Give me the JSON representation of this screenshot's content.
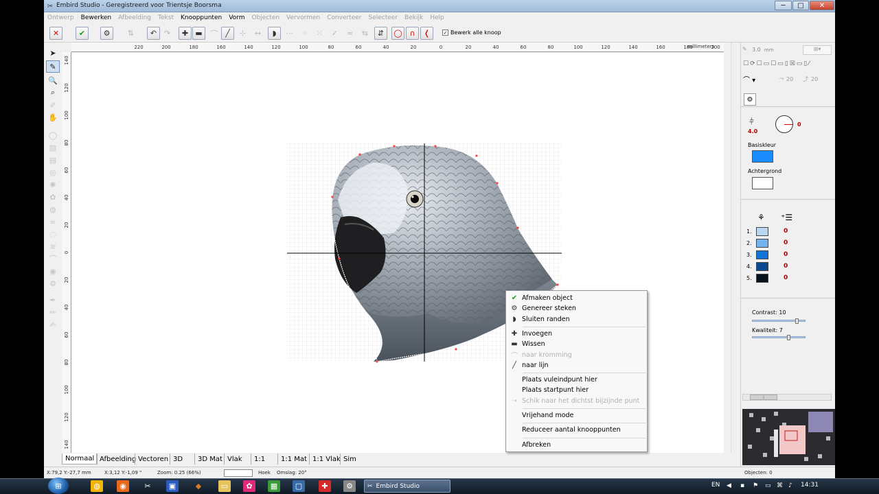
{
  "window": {
    "title": "Embird Studio - Geregistreerd voor Trientsje Boorsma",
    "buttons": {
      "minimize": "─",
      "maximize": "□",
      "close": "✕"
    }
  },
  "menu": [
    {
      "label": "Ontwerp",
      "enabled": false
    },
    {
      "label": "Bewerken",
      "enabled": true
    },
    {
      "label": "Afbeelding",
      "enabled": false
    },
    {
      "label": "Tekst",
      "enabled": false
    },
    {
      "label": "Knooppunten",
      "enabled": true
    },
    {
      "label": "Vorm",
      "enabled": true
    },
    {
      "label": "Objecten",
      "enabled": false
    },
    {
      "label": "Vervormen",
      "enabled": false
    },
    {
      "label": "Converteer",
      "enabled": false
    },
    {
      "label": "Selecteer",
      "enabled": false
    },
    {
      "label": "Bekijk",
      "enabled": false
    },
    {
      "label": "Help",
      "enabled": false
    }
  ],
  "toolbar": {
    "checkbox_label": "Bewerk alle knoop",
    "checkbox_checked": true
  },
  "ruler": {
    "h_labels": [
      "220",
      "200",
      "180",
      "160",
      "140",
      "120",
      "100",
      "80",
      "60",
      "40",
      "20",
      "0",
      "20",
      "40",
      "60",
      "80",
      "100",
      "120",
      "140",
      "160",
      "180",
      "200"
    ],
    "unit": "millimeters",
    "v_labels": [
      "140",
      "120",
      "100",
      "80",
      "60",
      "40",
      "20",
      "0",
      "20",
      "40",
      "60",
      "80",
      "100",
      "120",
      "140"
    ]
  },
  "right_panel": {
    "thickness": "3.0",
    "thickness_unit": "mm",
    "angle1": "20",
    "angle2": "20",
    "density": "4.0",
    "angle_value": "0",
    "basiskleur_label": "Basiskleur",
    "basiskleur_color": "#1a8cff",
    "achtergrond_label": "Achtergrond",
    "achtergrond_color": "#ffffff",
    "threads": [
      {
        "index": "1.",
        "color": "#b9d7f2",
        "count": "0"
      },
      {
        "index": "2.",
        "color": "#73b3f0",
        "count": "0"
      },
      {
        "index": "3.",
        "color": "#1273d9",
        "count": "0"
      },
      {
        "index": "4.",
        "color": "#0b4a8f",
        "count": "0"
      },
      {
        "index": "5.",
        "color": "#06121c",
        "count": "0"
      }
    ],
    "contrast_label": "Contrast: 10",
    "contrast_value": 0.86,
    "kwaliteit_label": "Kwaliteit: 7",
    "kwaliteit_value": 0.7
  },
  "tabs": [
    {
      "label": "Normaal",
      "active": true
    },
    {
      "label": "Afbeelding",
      "active": false
    },
    {
      "label": "Vectoren",
      "active": false
    },
    {
      "label": "3D",
      "active": false
    },
    {
      "label": "3D Mat",
      "active": false
    },
    {
      "label": "Vlak",
      "active": false
    },
    {
      "label": "1:1",
      "active": false
    },
    {
      "label": "1:1 Mat",
      "active": false
    },
    {
      "label": "1:1 Vlak",
      "active": false
    },
    {
      "label": "Sim",
      "active": false
    }
  ],
  "status": {
    "coords": "X:79,2  Y:-27,7 mm",
    "delta": "X:3,12  Y:-1,09 \"",
    "zoom": "Zoom: 0.25 (66%)",
    "hoek": "Hoek",
    "omslag": "Omslag: 20°",
    "objecten": "Objecten: 0"
  },
  "context_menu": {
    "items": [
      {
        "label": "Afmaken object",
        "icon": "✔",
        "enabled": true,
        "icon_color": "#1a9a1a"
      },
      {
        "label": "Genereer steken",
        "icon": "⚙",
        "enabled": true
      },
      {
        "label": "Sluiten randen",
        "icon": "◗",
        "enabled": true
      },
      {
        "sep": true
      },
      {
        "label": "Invoegen",
        "icon": "✚",
        "enabled": true
      },
      {
        "label": "Wissen",
        "icon": "▬",
        "enabled": true
      },
      {
        "label": "naar kromming",
        "icon": "⌒",
        "enabled": false
      },
      {
        "label": "naar lijn",
        "icon": "╱",
        "enabled": true
      },
      {
        "sep": true
      },
      {
        "label": "Plaats vuleindpunt hier",
        "icon": "",
        "enabled": true
      },
      {
        "label": "Plaats startpunt hier",
        "icon": "",
        "enabled": true
      },
      {
        "label": "Schik naar het dichtst bijzijnde punt",
        "icon": "⇢",
        "enabled": false
      },
      {
        "sep": true
      },
      {
        "label": "Vrijehand mode",
        "icon": "",
        "enabled": true
      },
      {
        "sep": true
      },
      {
        "label": "Reduceer aantal knooppunten",
        "icon": "",
        "enabled": true
      },
      {
        "sep": true
      },
      {
        "label": "Afbreken",
        "icon": "",
        "enabled": true
      }
    ]
  },
  "taskbar": {
    "active_task": "Embird Studio",
    "lang": "EN",
    "clock": "14:31"
  }
}
